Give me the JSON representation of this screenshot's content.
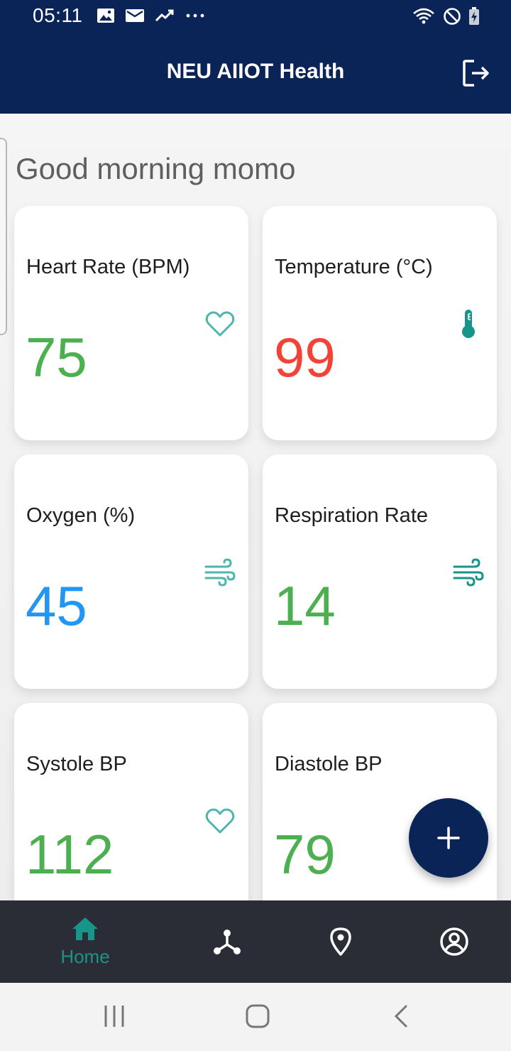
{
  "status_bar": {
    "time": "05:11",
    "left_icons": [
      "image-icon",
      "mail-icon",
      "trending-icon",
      "more-dots-icon"
    ],
    "right_icons": [
      "wifi-icon",
      "do-not-disturb-icon",
      "battery-charging-icon"
    ]
  },
  "app_bar": {
    "title": "NEU AIIOT Health",
    "logout_icon": "logout-icon"
  },
  "greeting": "Good morning momo",
  "cards": [
    {
      "label": "Heart Rate (BPM)",
      "value": "75",
      "color": "#4caf50",
      "icon": "heart-icon"
    },
    {
      "label": "Temperature (°C)",
      "value": "99",
      "color": "#f44336",
      "icon": "thermometer-icon"
    },
    {
      "label": "Oxygen (%)",
      "value": "45",
      "color": "#2196f3",
      "icon": "wind-icon"
    },
    {
      "label": "Respiration Rate",
      "value": "14",
      "color": "#4caf50",
      "icon": "wind-icon"
    },
    {
      "label": "Systole BP",
      "value": "112",
      "color": "#4caf50",
      "icon": "heart-icon"
    },
    {
      "label": "Diastole BP",
      "value": "79",
      "color": "#4caf50",
      "icon": "heart-icon"
    }
  ],
  "fab": {
    "icon": "plus-icon"
  },
  "bottom_nav": {
    "items": [
      {
        "label": "Home",
        "icon": "home-icon",
        "active": true
      },
      {
        "label": "",
        "icon": "network-icon",
        "active": false
      },
      {
        "label": "",
        "icon": "location-pin-icon",
        "active": false
      },
      {
        "label": "",
        "icon": "account-circle-icon",
        "active": false
      }
    ]
  },
  "system_nav": {
    "icons": [
      "recents-icon",
      "home-outline-icon",
      "back-icon"
    ]
  },
  "colors": {
    "primary": "#0b2457",
    "accent": "#17958b",
    "nav_background": "#2b2d36",
    "icon_teal": "#4fb6ad"
  }
}
